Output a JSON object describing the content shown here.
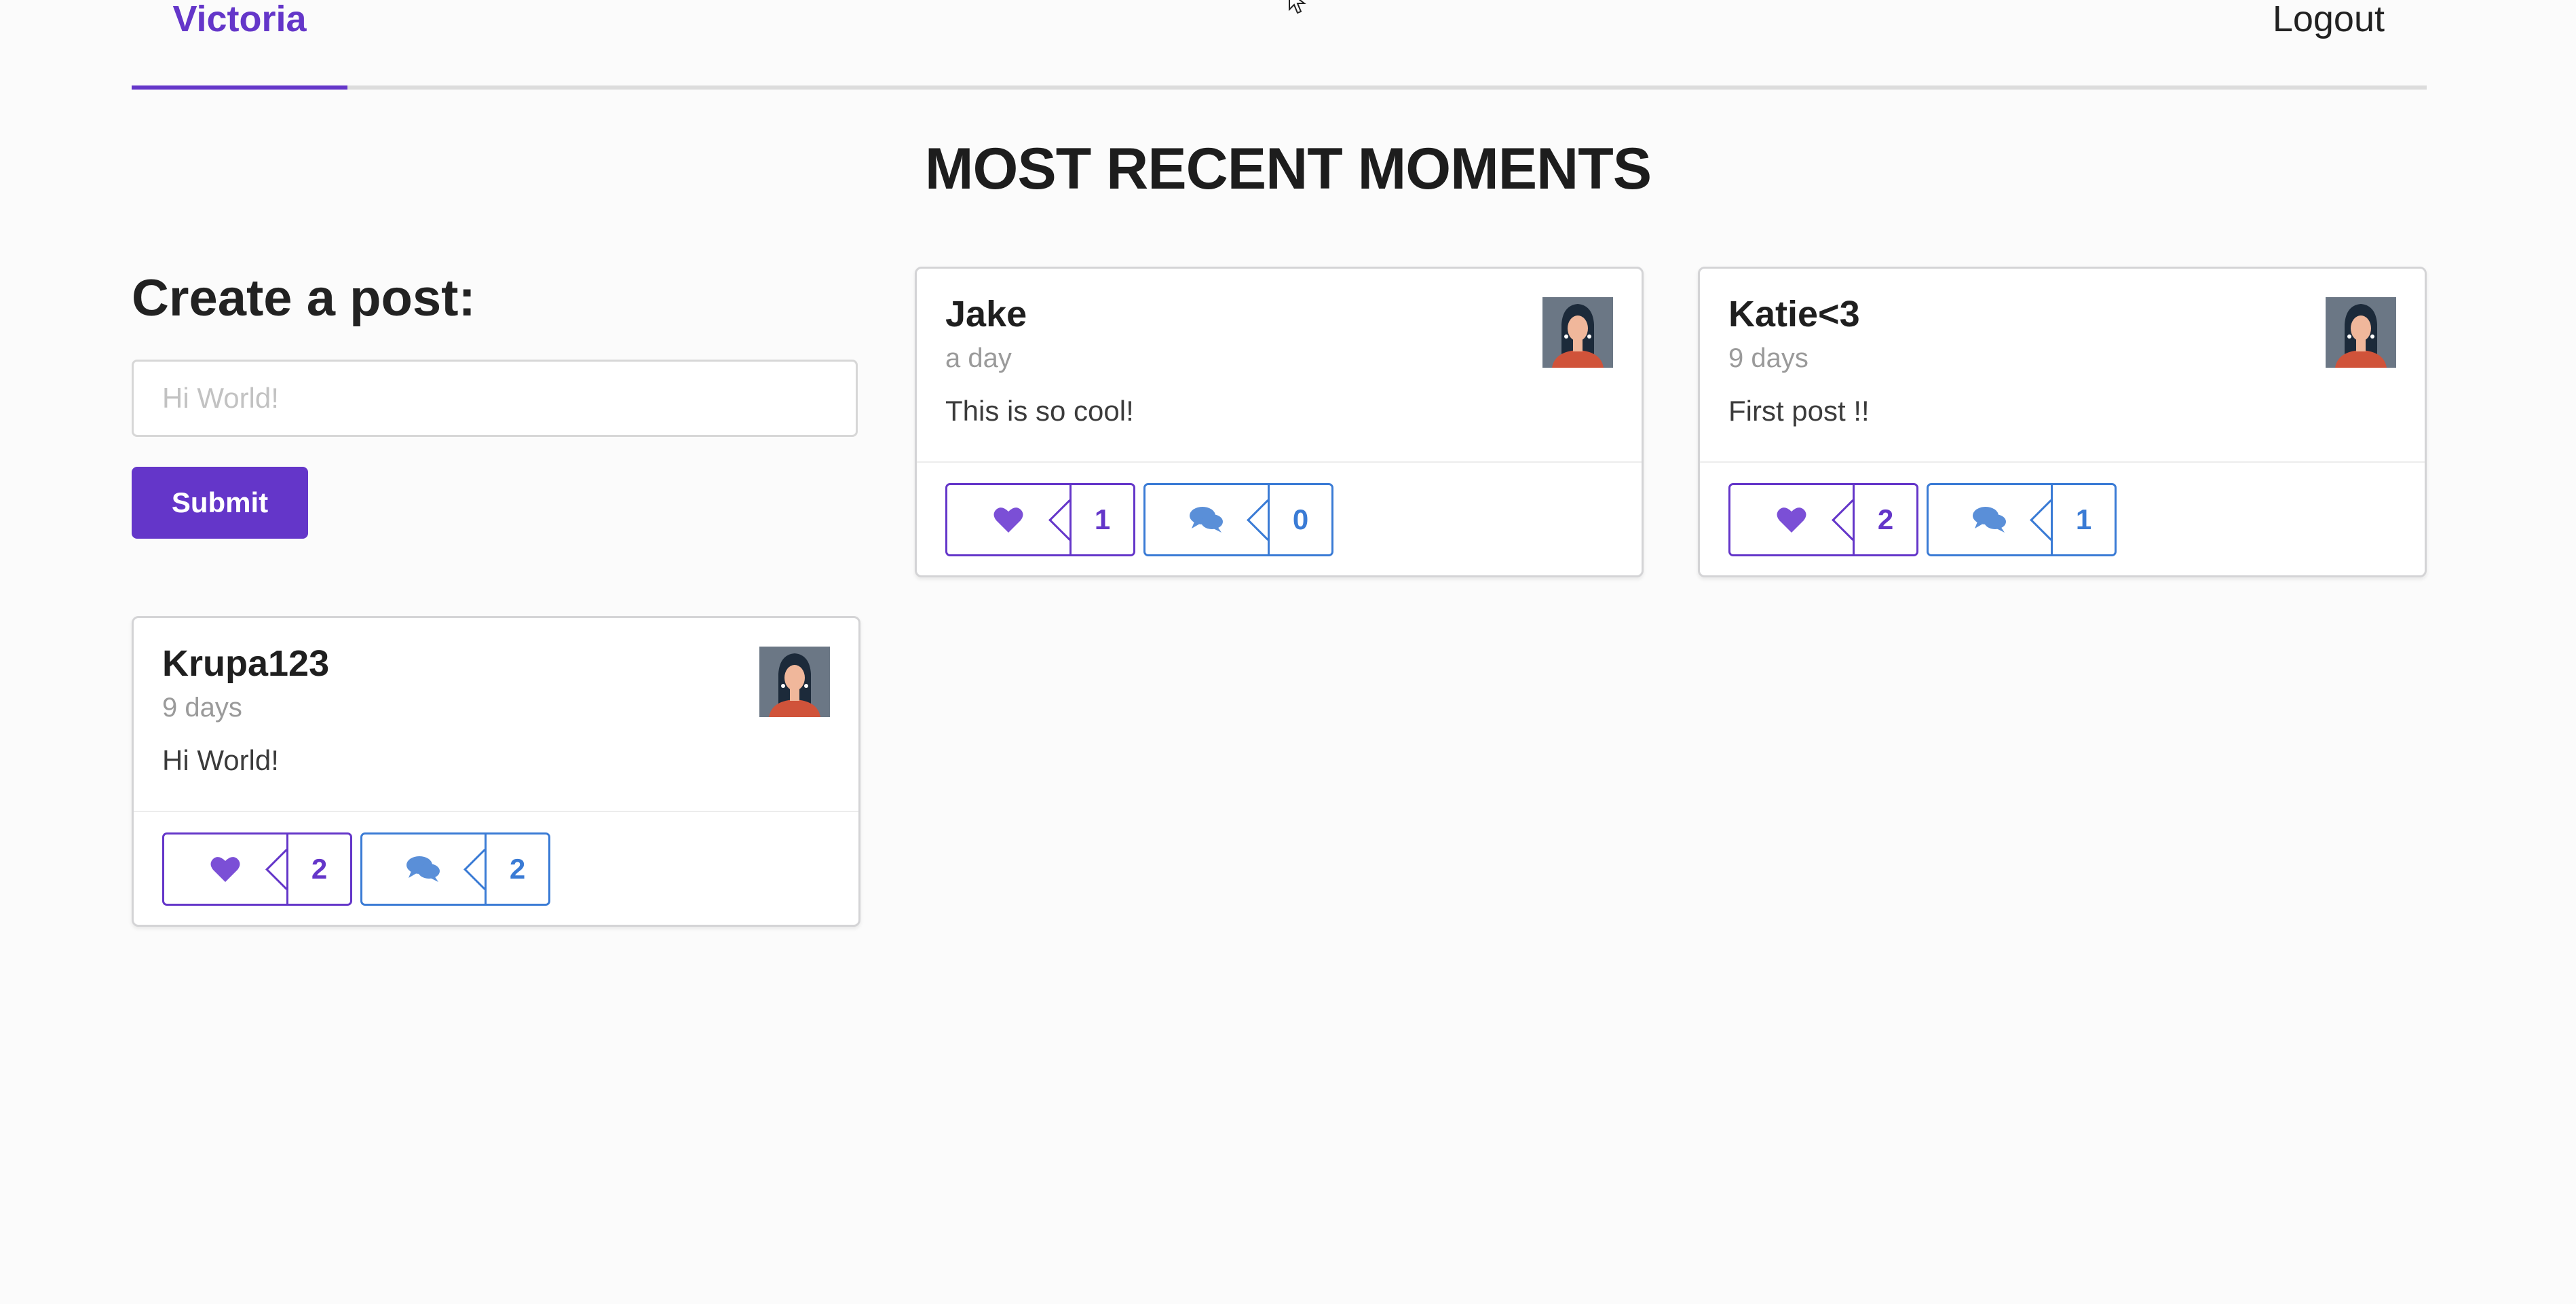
{
  "nav": {
    "user_label": "Victoria",
    "logout_label": "Logout"
  },
  "page": {
    "title": "MOST RECENT MOMENTS"
  },
  "create_post": {
    "heading": "Create a post:",
    "placeholder": "Hi World!",
    "value": "",
    "submit_label": "Submit"
  },
  "colors": {
    "accent": "#6436c9",
    "comment": "#3a7bd5"
  },
  "posts": [
    {
      "author": "Jake",
      "time": "a day",
      "text": "This is so cool!",
      "likes": "1",
      "comments": "0",
      "icons": {
        "like": "heart-icon",
        "comment": "comments-icon",
        "avatar": "avatar"
      }
    },
    {
      "author": "Katie<3",
      "time": "9 days",
      "text": "First post !!",
      "likes": "2",
      "comments": "1",
      "icons": {
        "like": "heart-icon",
        "comment": "comments-icon",
        "avatar": "avatar"
      }
    },
    {
      "author": "Krupa123",
      "time": "9 days",
      "text": "Hi World!",
      "likes": "2",
      "comments": "2",
      "icons": {
        "like": "heart-icon",
        "comment": "comments-icon",
        "avatar": "avatar"
      }
    }
  ]
}
